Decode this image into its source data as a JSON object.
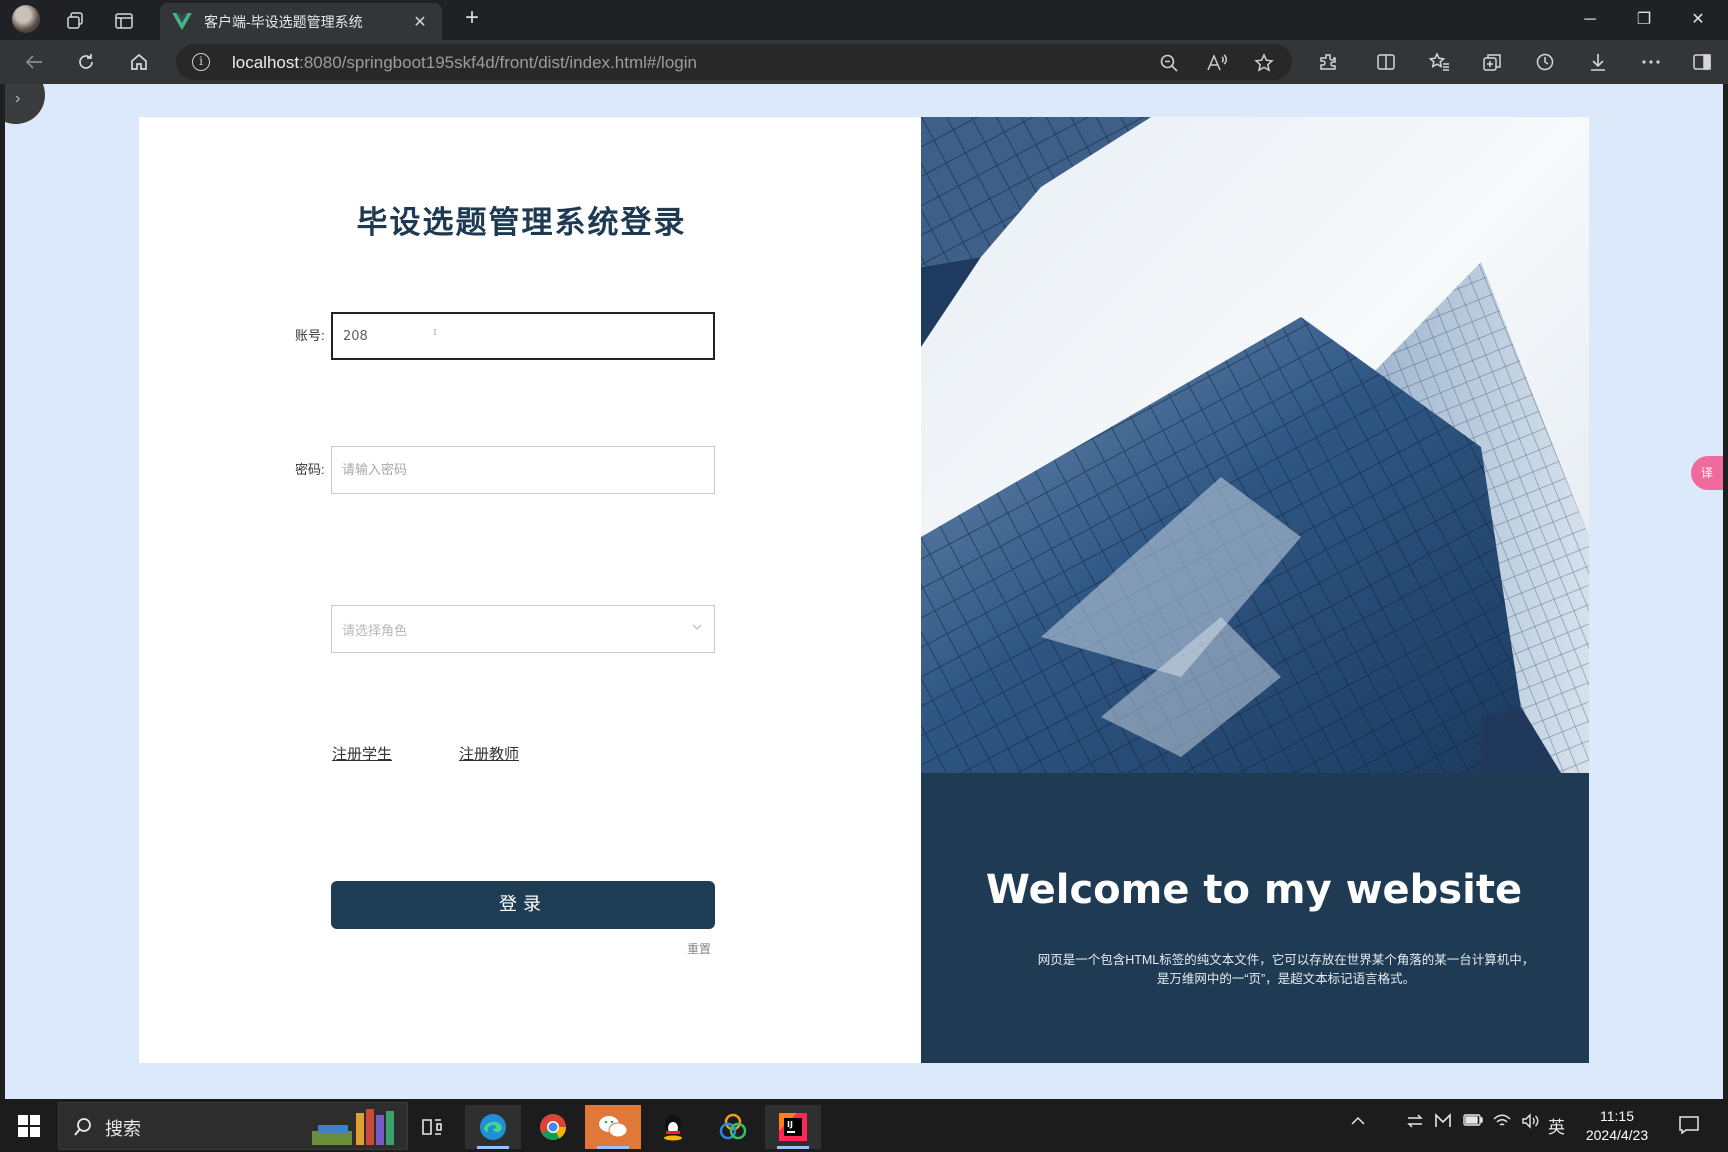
{
  "browser": {
    "tab_title": "客户端-毕设选题管理系统",
    "url_host": "localhost",
    "url_rest": ":8080/springboot195skf4d/front/dist/index.html#/login"
  },
  "login": {
    "title": "毕设选题管理系统登录",
    "account_label": "账号:",
    "account_value": "208",
    "password_label": "密码:",
    "password_placeholder": "请输入密码",
    "role_placeholder": "请选择角色",
    "register_student": "注册学生",
    "register_teacher": "注册教师",
    "login_button": "登录",
    "reset_button": "重置"
  },
  "hero": {
    "welcome": "Welcome to my website",
    "desc_line1": "网页是一个包含HTML标签的纯文本文件，它可以存放在世界某个角落的某一台计算机中，",
    "desc_line2": "是万维网中的一“页”，是超文本标记语言格式。"
  },
  "translate_fab": "译",
  "taskbar": {
    "search_text": "搜索",
    "ime": "英",
    "time": "11:15",
    "date": "2024/4/23"
  },
  "colors": {
    "primary_dark": "#1f3c55",
    "page_bg": "#dbe9fb"
  }
}
